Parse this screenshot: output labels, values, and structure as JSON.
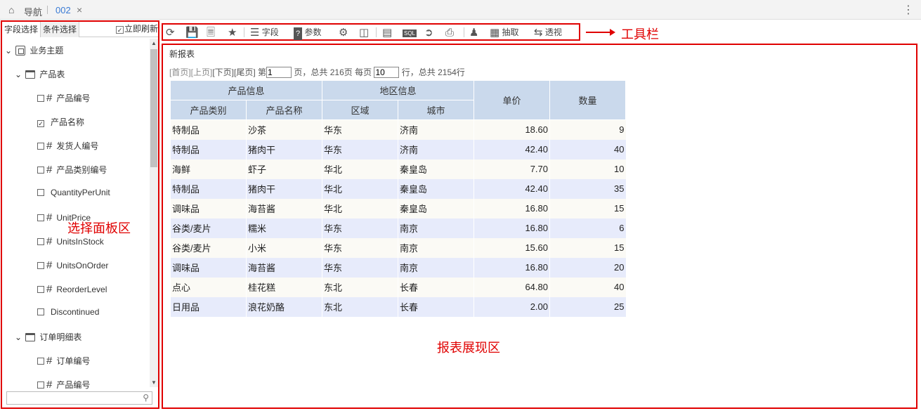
{
  "nav": {
    "label": "导航",
    "tab": "002",
    "close": "×",
    "more": "⋮"
  },
  "left_panel": {
    "tabs": [
      "字段选择",
      "条件选择"
    ],
    "refresh_label": "立即刷新",
    "tree": [
      {
        "label": "业务主题",
        "kind": "root"
      },
      {
        "label": "产品表",
        "kind": "table"
      },
      {
        "label": "产品编号",
        "kind": "num",
        "checked": false
      },
      {
        "label": "产品名称",
        "kind": "text",
        "checked": true
      },
      {
        "label": "发货人编号",
        "kind": "num",
        "checked": false
      },
      {
        "label": "产品类别编号",
        "kind": "num",
        "checked": false
      },
      {
        "label": "QuantityPerUnit",
        "kind": "text",
        "checked": false
      },
      {
        "label": "UnitPrice",
        "kind": "num",
        "checked": false
      },
      {
        "label": "UnitsInStock",
        "kind": "num",
        "checked": false
      },
      {
        "label": "UnitsOnOrder",
        "kind": "num",
        "checked": false
      },
      {
        "label": "ReorderLevel",
        "kind": "num",
        "checked": false
      },
      {
        "label": "Discontinued",
        "kind": "text",
        "checked": false
      },
      {
        "label": "订单明细表",
        "kind": "table"
      },
      {
        "label": "订单编号",
        "kind": "num",
        "checked": false
      },
      {
        "label": "产品编号",
        "kind": "num",
        "checked": false
      }
    ],
    "search_placeholder": ""
  },
  "toolbar": {
    "field_label": "字段",
    "param_label": "参数",
    "extract_label": "抽取",
    "pivot_label": "透视",
    "sql_label": "SQL"
  },
  "annotations": {
    "toolbar": "工具栏",
    "select_panel": "选择面板区",
    "report_area": "报表展现区"
  },
  "report": {
    "title": "新报表",
    "pager": {
      "first": "[首页]",
      "prev": "[上页]",
      "next": "[下页]",
      "last": "[尾页]",
      "page_prefix": "第",
      "page_value": "1",
      "page_suffix": "页，总共 216页 每页",
      "per_page_value": "10",
      "rows_suffix": "行，总共 2154行"
    },
    "group_headers": [
      "产品信息",
      "地区信息"
    ],
    "headers": [
      "产品类别",
      "产品名称",
      "区域",
      "城市",
      "单价",
      "数量"
    ],
    "rows": [
      [
        "特制品",
        "沙茶",
        "华东",
        "济南",
        "18.60",
        "9"
      ],
      [
        "特制品",
        "猪肉干",
        "华东",
        "济南",
        "42.40",
        "40"
      ],
      [
        "海鲜",
        "虾子",
        "华北",
        "秦皇岛",
        "7.70",
        "10"
      ],
      [
        "特制品",
        "猪肉干",
        "华北",
        "秦皇岛",
        "42.40",
        "35"
      ],
      [
        "调味品",
        "海苔酱",
        "华北",
        "秦皇岛",
        "16.80",
        "15"
      ],
      [
        "谷类/麦片",
        "糯米",
        "华东",
        "南京",
        "16.80",
        "6"
      ],
      [
        "谷类/麦片",
        "小米",
        "华东",
        "南京",
        "15.60",
        "15"
      ],
      [
        "调味品",
        "海苔酱",
        "华东",
        "南京",
        "16.80",
        "20"
      ],
      [
        "点心",
        "桂花糕",
        "东北",
        "长春",
        "64.80",
        "40"
      ],
      [
        "日用品",
        "浪花奶酪",
        "东北",
        "长春",
        "2.00",
        "25"
      ]
    ]
  }
}
